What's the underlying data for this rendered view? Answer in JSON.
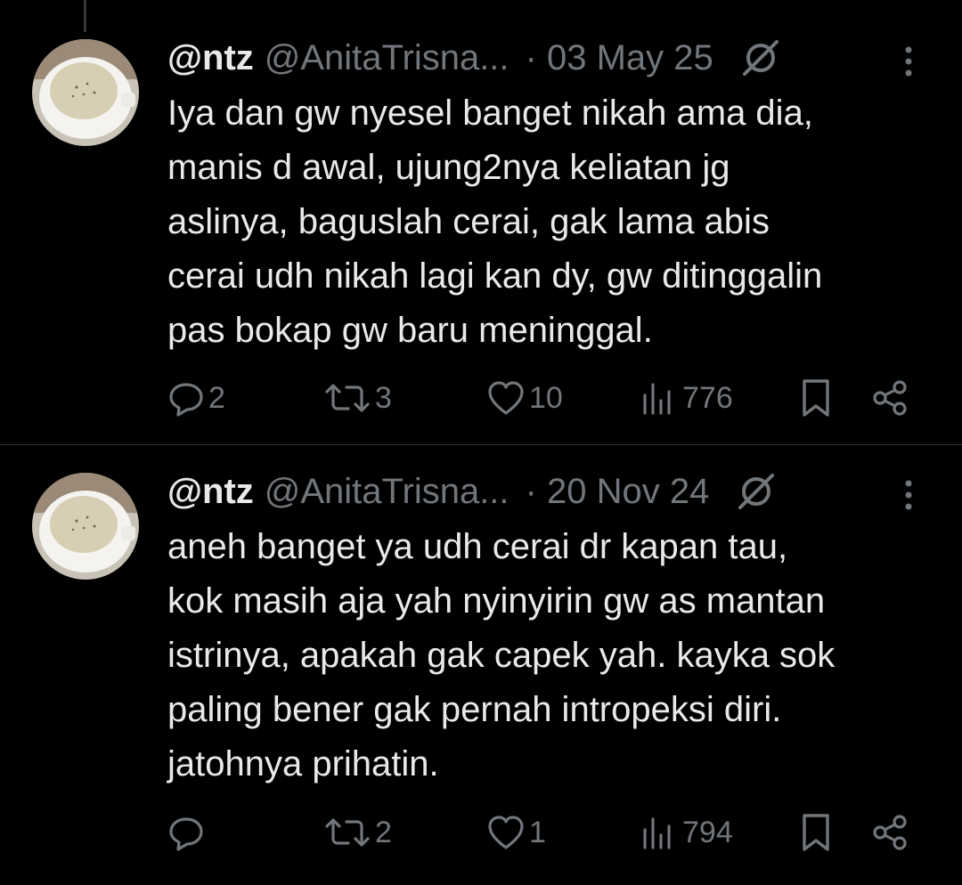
{
  "tweets": [
    {
      "display_name": "@ntz",
      "handle": "@AnitaTrisna...",
      "date": "· 03 May 25",
      "text": "Iya dan gw nyesel banget nikah ama dia,\nmanis d awal, ujung2nya keliatan jg\naslinya, baguslah cerai, gak lama abis\ncerai udh nikah lagi kan dy, gw ditinggalin\npas bokap gw baru meninggal.",
      "replies": "2",
      "reposts": "3",
      "likes": "10",
      "views": "776"
    },
    {
      "display_name": "@ntz",
      "handle": "@AnitaTrisna...",
      "date": "· 20 Nov 24",
      "text": "aneh banget ya udh cerai dr kapan tau,\nkok masih aja yah nyinyirin gw as mantan\nistrinya, apakah gak capek yah. kayka sok\npaling bener gak pernah intropeksi diri.\njatohnya prihatin.",
      "replies": "",
      "reposts": "2",
      "likes": "1",
      "views": "794"
    }
  ],
  "icons": {
    "verified": "circle-slash-icon",
    "more": "more-vertical-icon",
    "reply": "reply-icon",
    "repost": "repost-icon",
    "like": "heart-icon",
    "views": "views-icon",
    "bookmark": "bookmark-icon",
    "share": "share-icon"
  },
  "colors": {
    "background": "#000000",
    "text": "#e7e9ea",
    "secondary": "#71767b",
    "divider": "#2f3336"
  }
}
